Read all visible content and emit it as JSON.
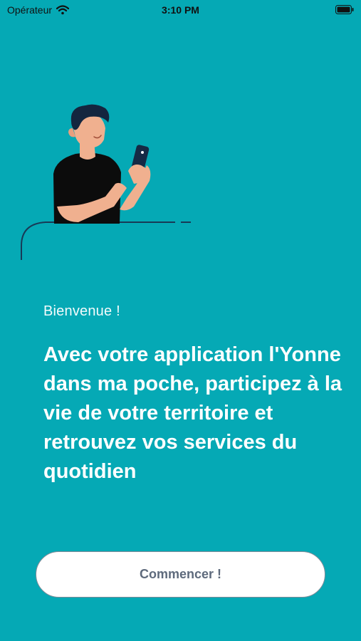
{
  "status_bar": {
    "carrier": "Opérateur",
    "time": "3:10 PM"
  },
  "onboarding": {
    "greeting": "Bienvenue !",
    "headline": "Avec votre application l'Yonne dans ma poche, participez à la vie de votre territoire et retrouvez vos services du quotidien",
    "start_label": "Commencer !"
  },
  "icons": {
    "wifi": "wifi-icon",
    "battery": "battery-icon",
    "illustration": "person-with-phone"
  },
  "colors": {
    "background": "#05a9b5",
    "button_text": "#5e6a7c"
  }
}
